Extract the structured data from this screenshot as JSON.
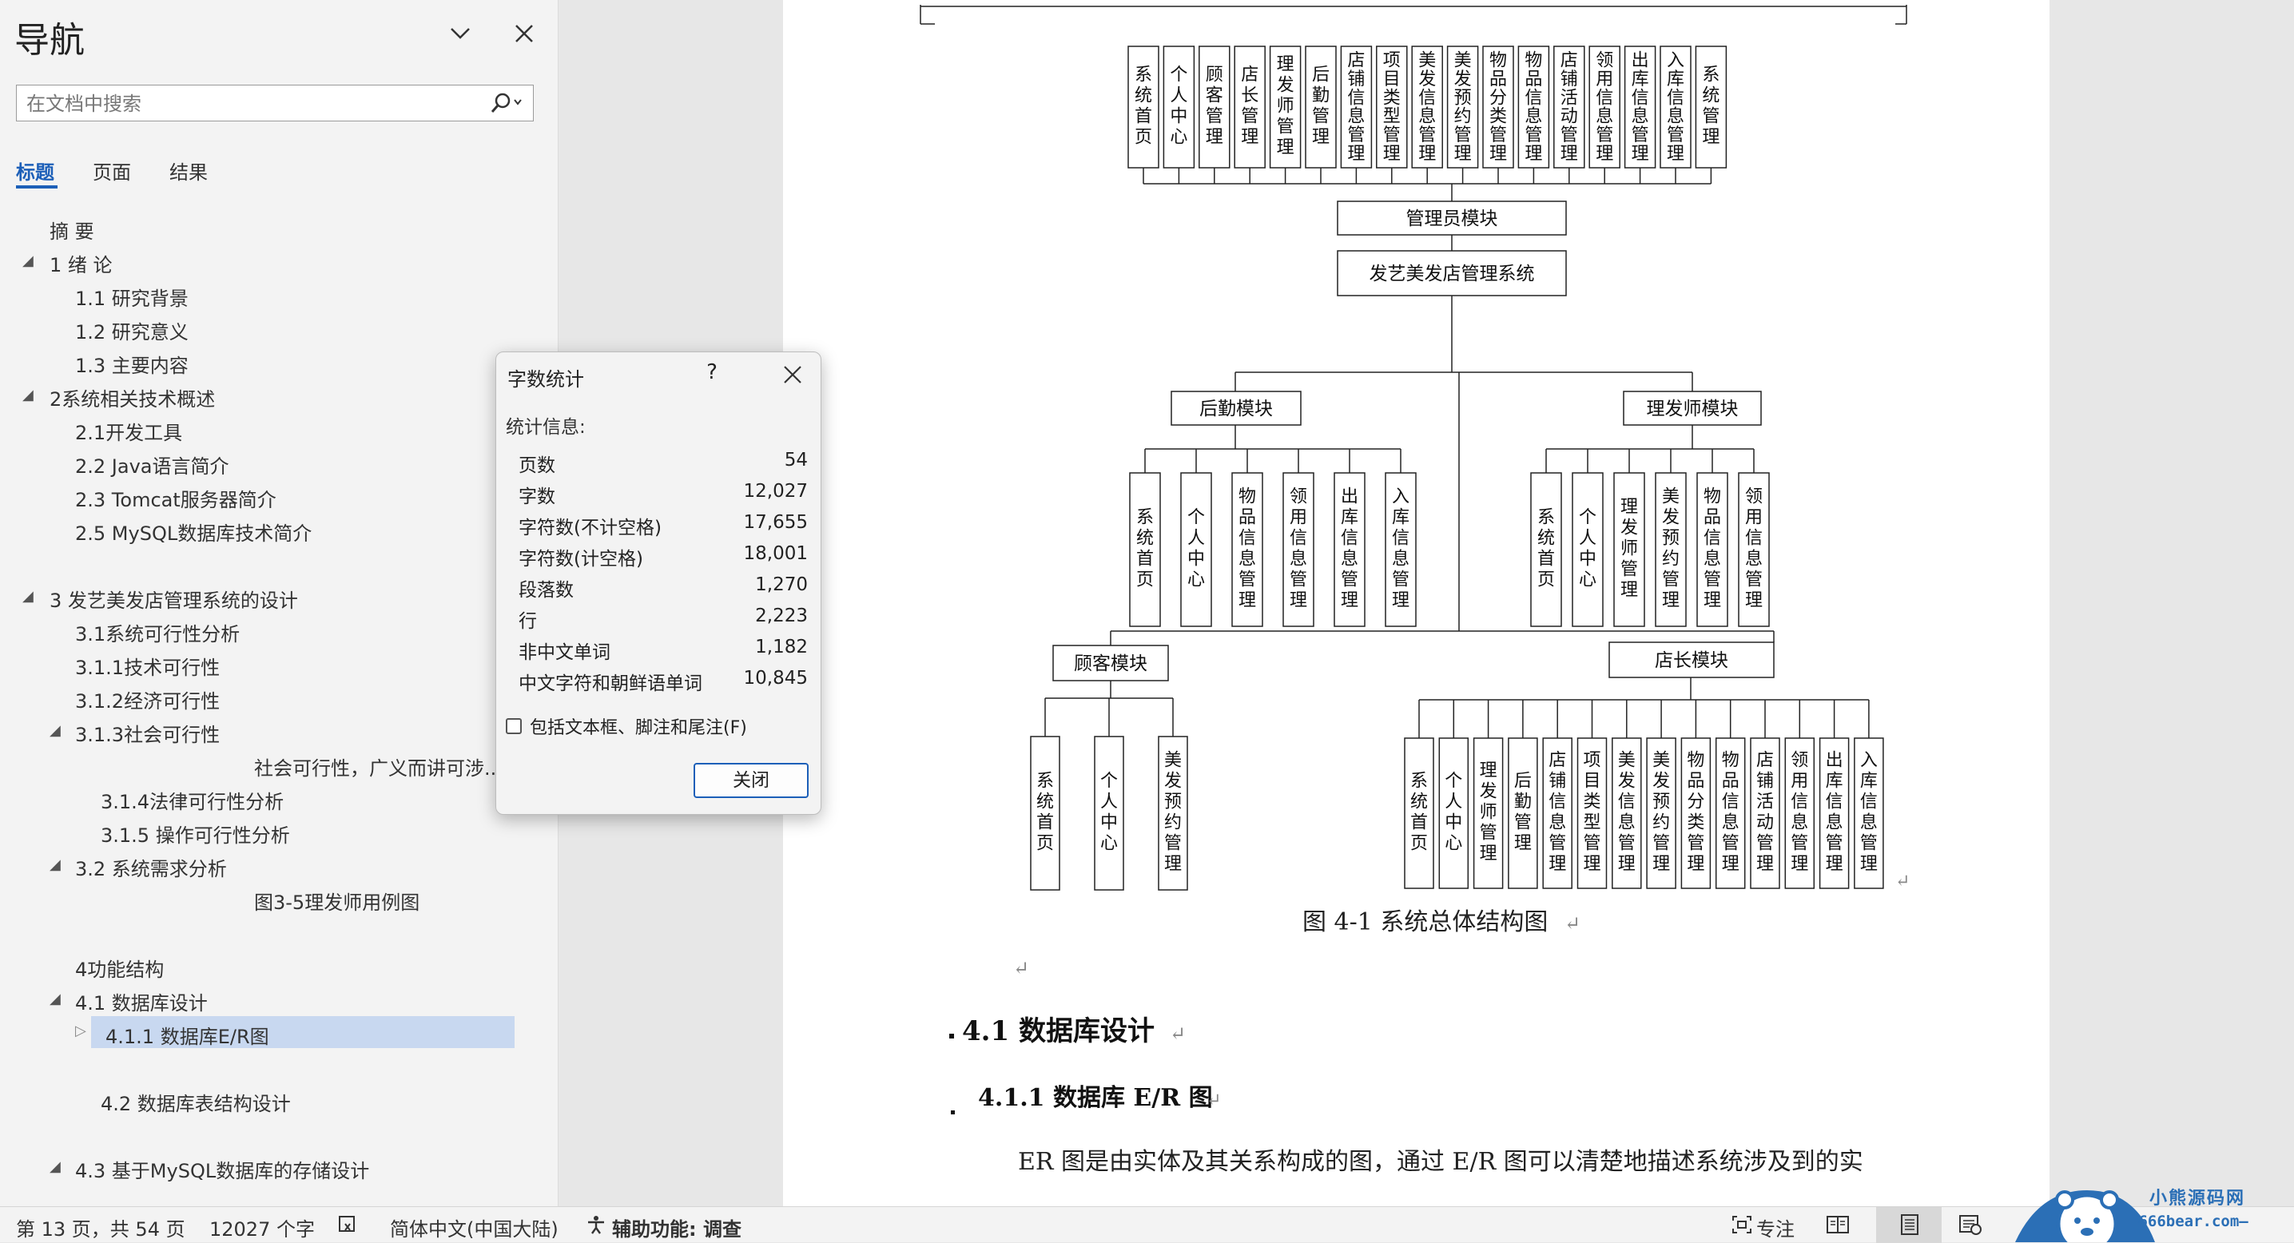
{
  "nav": {
    "title": "导航",
    "search_placeholder": "在文档中搜索",
    "tabs": [
      "标题",
      "页面",
      "结果"
    ],
    "headings": [
      "摘  要",
      "1 绪  论",
      "1.1 研究背景",
      "1.2 研究意义",
      "1.3 主要内容",
      "2系统相关技术概述",
      "2.1开发工具",
      "2.2 Java语言简介",
      "2.3 Tomcat服务器简介",
      "2.5 MySQL数据库技术简介",
      "3 发艺美发店管理系统的设计",
      "3.1系统可行性分析",
      "3.1.1技术可行性",
      "3.1.2经济可行性",
      "3.1.3社会可行性",
      "社会可行性，广义而讲可涉...",
      "3.1.4法律可行性分析",
      "3.1.5 操作可行性分析",
      "3.2 系统需求分析",
      "图3-5理发师用例图",
      "4功能结构",
      "4.1 数据库设计",
      "4.1.1 数据库E/R图",
      "4.2 数据库表结构设计",
      "4.3 基于MySQL数据库的存储设计"
    ]
  },
  "dialog": {
    "title": "字数统计",
    "help": "?",
    "info_label": "统计信息:",
    "stats": [
      {
        "label": "页数",
        "value": "54"
      },
      {
        "label": "字数",
        "value": "12,027"
      },
      {
        "label": "字符数(不计空格)",
        "value": "17,655"
      },
      {
        "label": "字符数(计空格)",
        "value": "18,001"
      },
      {
        "label": "段落数",
        "value": "1,270"
      },
      {
        "label": "行",
        "value": "2,223"
      },
      {
        "label": "非中文单词",
        "value": "1,182"
      },
      {
        "label": "中文字符和朝鲜语单词",
        "value": "10,845"
      }
    ],
    "checkbox_label": "包括文本框、脚注和尾注(F)",
    "close_button": "关闭"
  },
  "document": {
    "diagram": {
      "admin_items": [
        "系统首页",
        "个人中心",
        "顾客管理",
        "店长管理",
        "理发师管理",
        "后勤管理",
        "店铺信息管理",
        "项目类型管理",
        "美发信息管理",
        "美发预约管理",
        "物品分类管理",
        "物品信息管理",
        "店铺活动管理",
        "领用信息管理",
        "出库信息管理",
        "入库信息管理",
        "系统管理"
      ],
      "admin_module": "管理员模块",
      "root": "发艺美发店管理系统",
      "logistics_module": "后勤模块",
      "logistics_items": [
        "系统首页",
        "个人中心",
        "物品信息管理",
        "领用信息管理",
        "出库信息管理",
        "入库信息管理"
      ],
      "barber_module": "理发师模块",
      "barber_items": [
        "系统首页",
        "个人中心",
        "理发师管理",
        "美发预约管理",
        "物品信息管理",
        "领用信息管理"
      ],
      "customer_module": "顾客模块",
      "customer_items": [
        "系统首页",
        "个人中心",
        "美发预约管理"
      ],
      "manager_module": "店长模块",
      "manager_items": [
        "系统首页",
        "个人中心",
        "理发师管理",
        "后勤管理",
        "店铺信息管理",
        "项目类型管理",
        "美发信息管理",
        "美发预约管理",
        "物品分类管理",
        "物品信息管理",
        "店铺活动管理",
        "领用信息管理",
        "出库信息管理",
        "入库信息管理"
      ]
    },
    "caption": "图 4-1  系统总体结构图",
    "heading_1": "4.1  数据库设计",
    "heading_2": "4.1.1  数据库 E/R 图",
    "body_text": "ER 图是由实体及其关系构成的图，通过 E/R 图可以清楚地描述系统涉及到的实"
  },
  "status": {
    "page": "第 13 页，共 54 页",
    "word_count": "12027 个字",
    "language": "简体中文(中国大陆)",
    "accessibility": "辅助功能: 调查",
    "focus": "专注"
  },
  "watermark": {
    "title": "小熊源码网",
    "url": "—666bear.com—"
  }
}
